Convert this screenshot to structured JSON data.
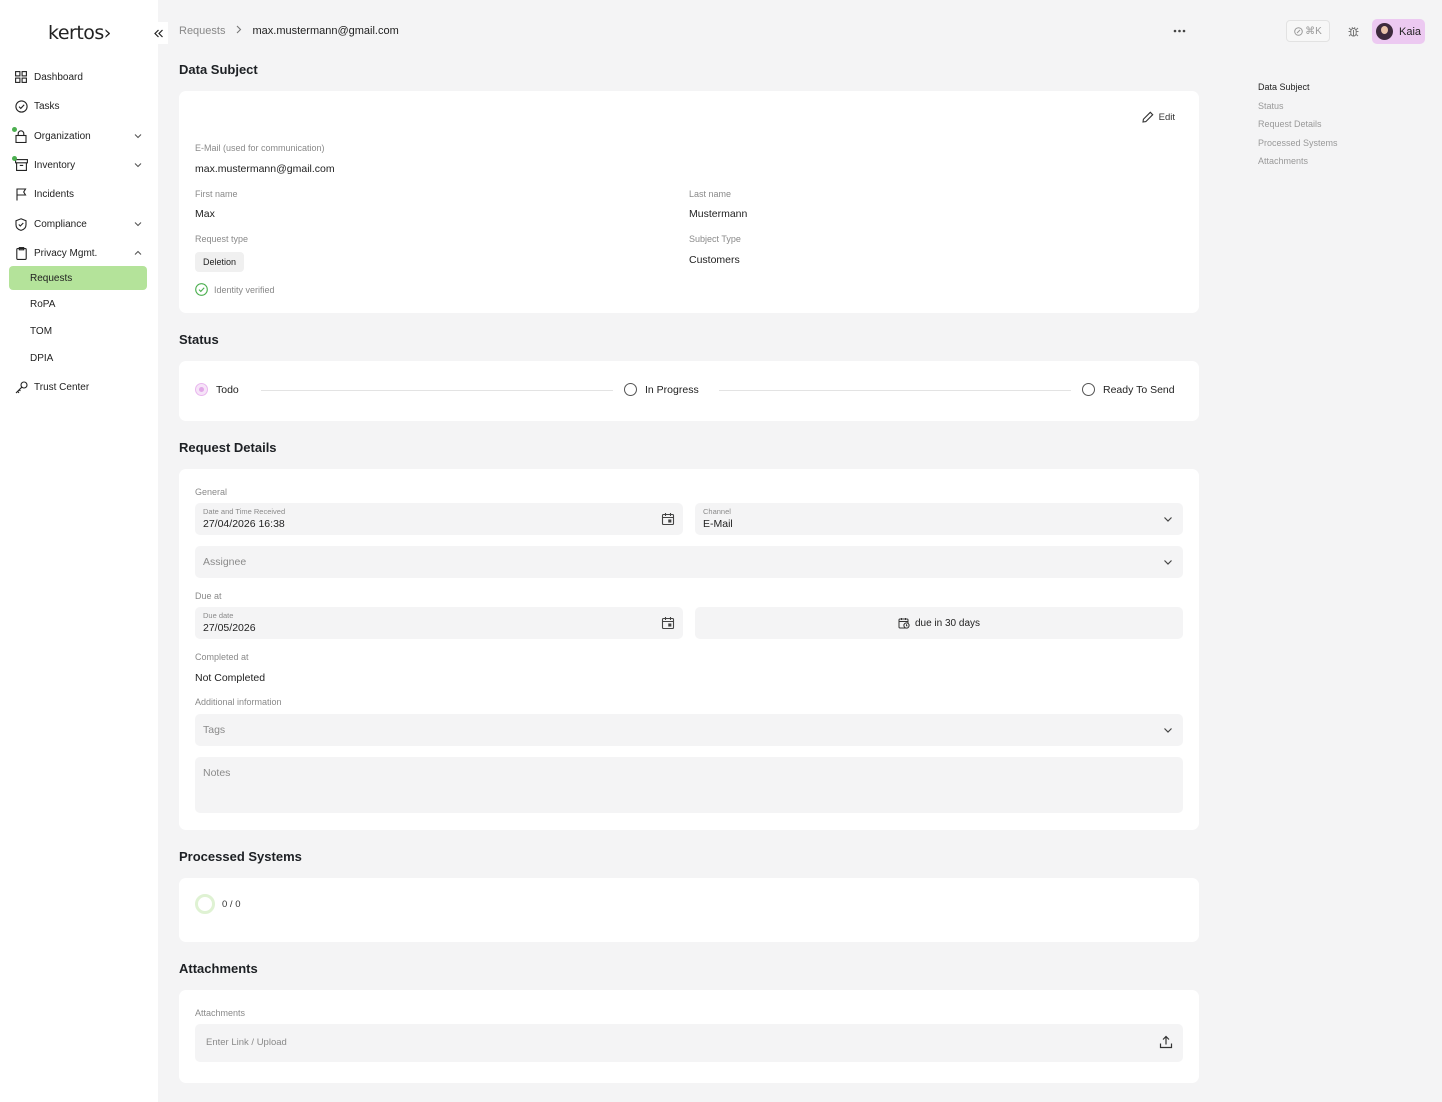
{
  "brand": {
    "logo_text": "kertos›"
  },
  "sidebar": {
    "items": [
      {
        "label": "Dashboard"
      },
      {
        "label": "Tasks"
      },
      {
        "label": "Organization"
      },
      {
        "label": "Inventory"
      },
      {
        "label": "Incidents"
      },
      {
        "label": "Compliance"
      },
      {
        "label": "Privacy Mgmt."
      },
      {
        "label": "Trust Center"
      }
    ],
    "privacy_sub": [
      {
        "label": "Requests"
      },
      {
        "label": "RoPA"
      },
      {
        "label": "TOM"
      },
      {
        "label": "DPIA"
      }
    ]
  },
  "breadcrumb": {
    "parent": "Requests",
    "current": "max.mustermann@gmail.com"
  },
  "topbar": {
    "shortcut": "⌘K",
    "user_name": "Kaia"
  },
  "data_subject": {
    "title": "Data Subject",
    "edit_label": "Edit",
    "email_label": "E-Mail (used for communication)",
    "email_value": "max.mustermann@gmail.com",
    "first_name_label": "First name",
    "first_name_value": "Max",
    "last_name_label": "Last name",
    "last_name_value": "Mustermann",
    "request_type_label": "Request type",
    "request_type_value": "Deletion",
    "subject_type_label": "Subject Type",
    "subject_type_value": "Customers",
    "identity_label": "Identity verified"
  },
  "status": {
    "title": "Status",
    "steps": [
      {
        "label": "Todo"
      },
      {
        "label": "In Progress"
      },
      {
        "label": "Ready To Send"
      }
    ],
    "current_step": "Todo"
  },
  "request_details": {
    "title": "Request Details",
    "general_label": "General",
    "date_label": "Date and Time Received",
    "date_value": "27/04/2026 16:38",
    "channel_label": "Channel",
    "channel_value": "E-Mail",
    "assignee_placeholder": "Assignee",
    "due_at_label": "Due at",
    "due_date_label": "Due date",
    "due_date_value": "27/05/2026",
    "due_in_label": "due in 30 days",
    "completed_label": "Completed at",
    "completed_value": "Not Completed",
    "additional_label": "Additional information",
    "tags_placeholder": "Tags",
    "notes_placeholder": "Notes"
  },
  "processed_systems": {
    "title": "Processed Systems",
    "progress": "0 / 0"
  },
  "attachments": {
    "title": "Attachments",
    "label": "Attachments",
    "placeholder": "Enter Link / Upload"
  },
  "toc": {
    "items": [
      {
        "label": "Data Subject"
      },
      {
        "label": "Status"
      },
      {
        "label": "Request Details"
      },
      {
        "label": "Processed Systems"
      },
      {
        "label": "Attachments"
      }
    ]
  }
}
